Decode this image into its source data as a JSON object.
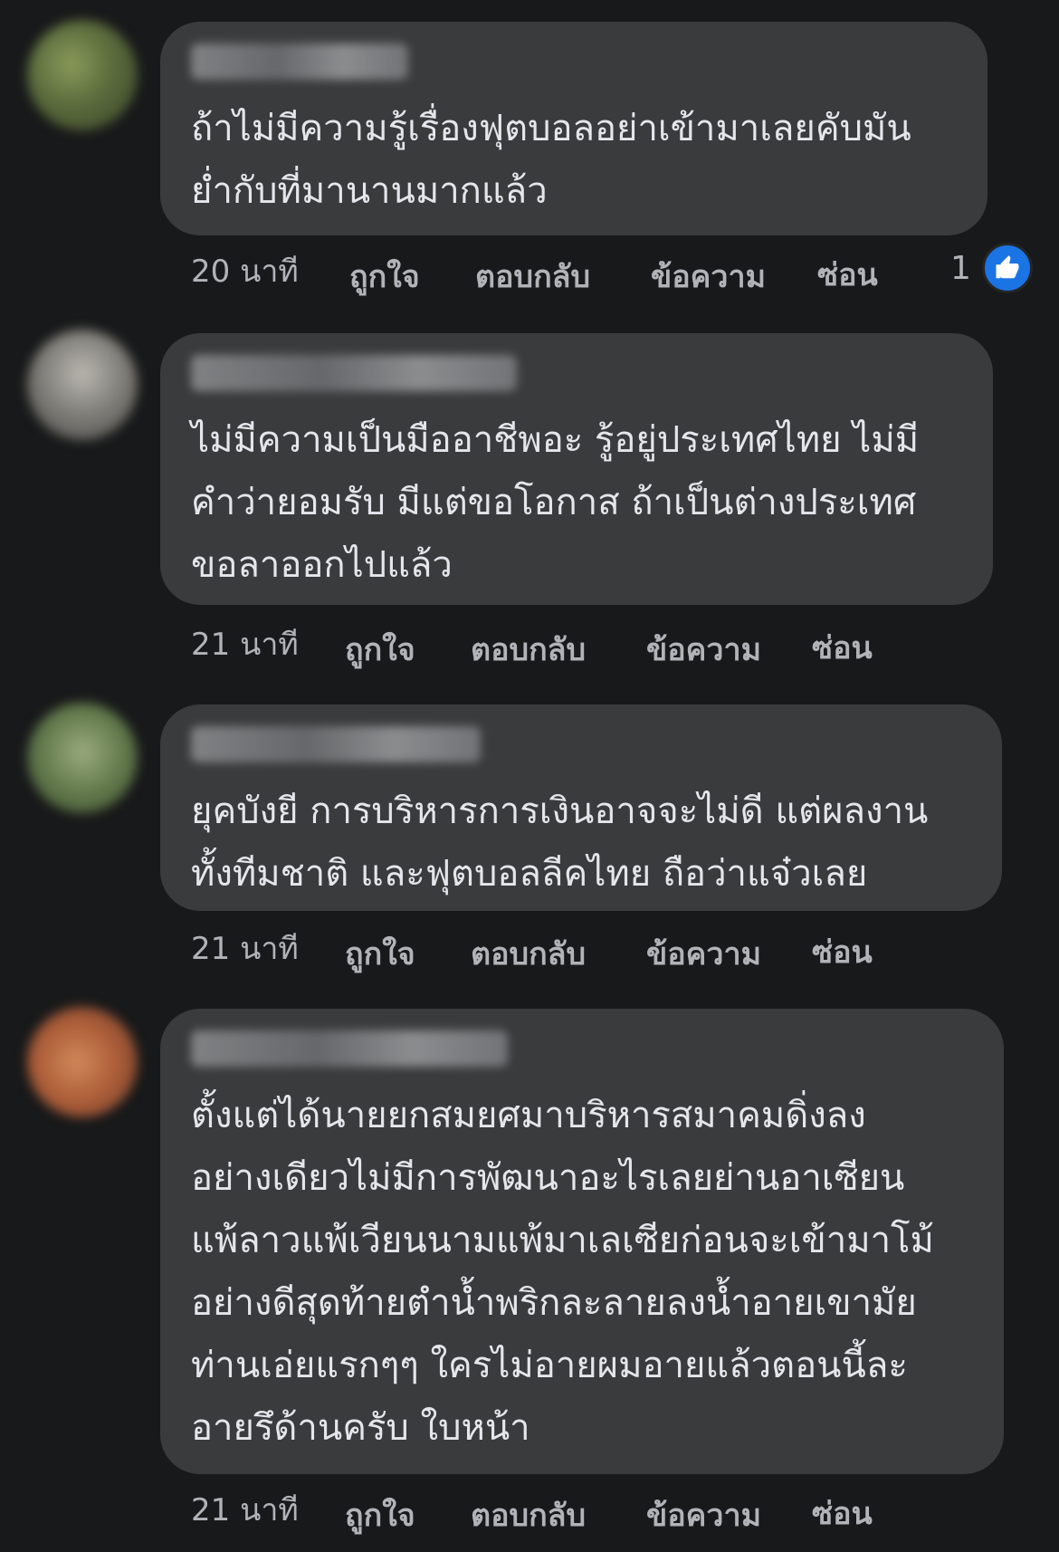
{
  "comments": [
    {
      "text": "ถ้าไม่มีความรู้เรื่องฟุตบอลอย่าเข้ามาเลยคับมัน\nย่ำกับที่มานานมากแล้ว",
      "time": "20 นาที",
      "like": "ถูกใจ",
      "reply": "ตอบกลับ",
      "message": "ข้อความ",
      "hide": "ซ่อน",
      "reaction_count": "1",
      "reaction_icon": "like-icon",
      "avatar_color": "#6d7a4e"
    },
    {
      "text": "ไม่มีความเป็นมืออาชีพอะ รู้อยู่ประเทศไทย ไม่มี\nคำว่ายอมรับ มีแต่ขอโอกาส ถ้าเป็นต่างประเทศ\nขอลาออกไปแล้ว",
      "time": "21 นาที",
      "like": "ถูกใจ",
      "reply": "ตอบกลับ",
      "message": "ข้อความ",
      "hide": "ซ่อน",
      "avatar_color": "#7a7a78"
    },
    {
      "text": "ยุคบังยี การบริหารการเงินอาจจะไม่ดี แต่ผลงาน\nทั้งทีมชาติ และฟุตบอลลีคไทย ถือว่าแจ๋วเลย",
      "time": "21 นาที",
      "like": "ถูกใจ",
      "reply": "ตอบกลับ",
      "message": "ข้อความ",
      "hide": "ซ่อน",
      "avatar_color": "#5c7a4a"
    },
    {
      "text": "ตั้งแต่ได้นายยกสมยศมาบริหารสมาคมดิ่งลง\nอย่างเดียวไม่มีการพัฒนาอะไรเลยย่านอาเซียน\nแพ้ลาวแพ้เวียนนามแพ้มาเลเซียก่อนจะเข้ามาโม้\nอย่างดีสุดท้ายตำน้ำพริกละลายลงน้ำอายเขามัย\nท่านเอ่ยแรกๆๆ ใครไม่อายผมอายแล้วตอนนี้ละ\nอายรึด้านครับ ใบหน้า",
      "time": "21 นาที",
      "like": "ถูกใจ",
      "reply": "ตอบกลับ",
      "message": "ข้อความ",
      "hide": "ซ่อน",
      "avatar_color": "#b0603a"
    }
  ]
}
